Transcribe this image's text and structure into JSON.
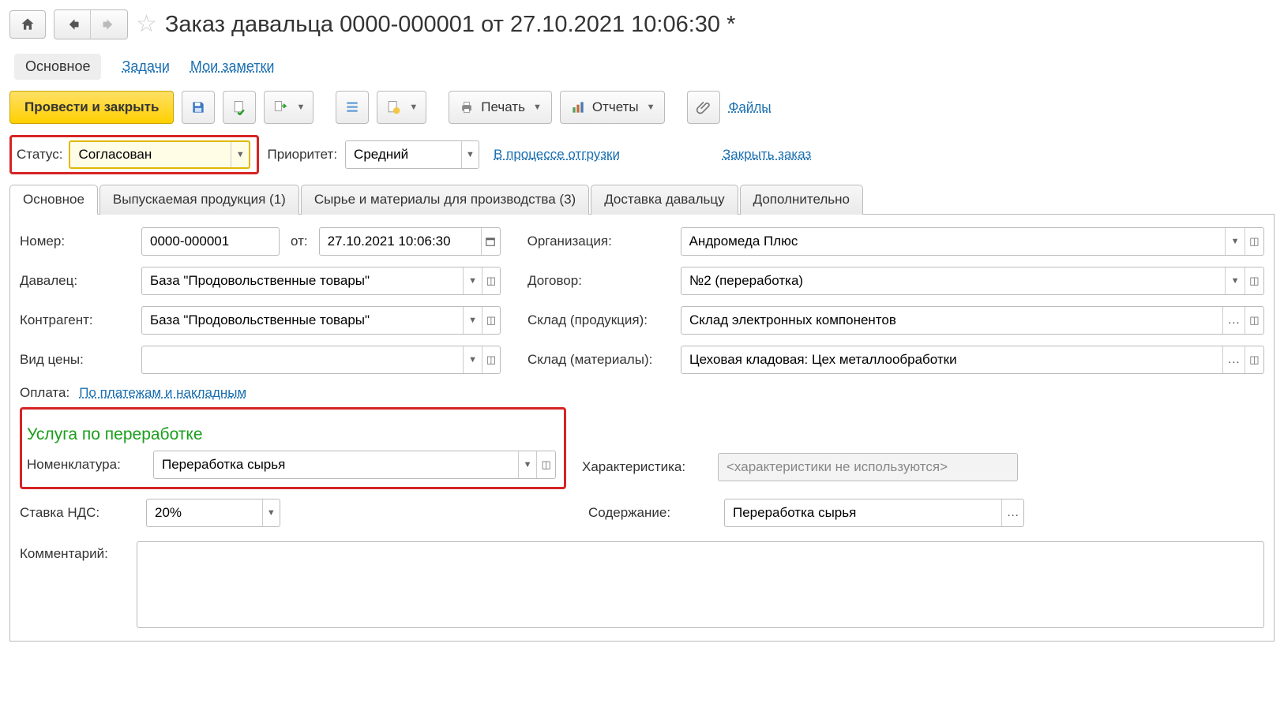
{
  "header": {
    "title": "Заказ давальца 0000-000001 от 27.10.2021 10:06:30 *"
  },
  "navTabs": {
    "main": "Основное",
    "tasks": "Задачи",
    "notes": "Мои заметки"
  },
  "toolbar": {
    "postAndClose": "Провести и закрыть",
    "print": "Печать",
    "reports": "Отчеты",
    "files": "Файлы"
  },
  "statusRow": {
    "statusLabel": "Статус:",
    "statusValue": "Согласован",
    "priorityLabel": "Приоритет:",
    "priorityValue": "Средний",
    "shippingLink": "В процессе отгрузки",
    "closeOrderLink": "Закрыть заказ"
  },
  "tabs": {
    "main": "Основное",
    "products": "Выпускаемая продукция (1)",
    "materials": "Сырье и материалы для производства (3)",
    "delivery": "Доставка давальцу",
    "extra": "Дополнительно"
  },
  "form": {
    "numberLabel": "Номер:",
    "numberValue": "0000-000001",
    "dateLabel": "от:",
    "dateValue": "27.10.2021 10:06:30",
    "orgLabel": "Организация:",
    "orgValue": "Андромеда Плюс",
    "supplierLabel": "Давалец:",
    "supplierValue": "База \"Продовольственные товары\"",
    "contractLabel": "Договор:",
    "contractValue": "№2 (переработка)",
    "counterpartyLabel": "Контрагент:",
    "counterpartyValue": "База \"Продовольственные товары\"",
    "prodWarehouseLabel": "Склад (продукция):",
    "prodWarehouseValue": "Склад электронных компонентов",
    "priceTypeLabel": "Вид цены:",
    "priceTypeValue": "",
    "matWarehouseLabel": "Склад (материалы):",
    "matWarehouseValue": "Цеховая кладовая: Цех металлообработки",
    "paymentLabel": "Оплата:",
    "paymentLink": "По платежам и накладным"
  },
  "service": {
    "title": "Услуга по переработке",
    "nomenclatureLabel": "Номенклатура:",
    "nomenclatureValue": "Переработка сырья",
    "characteristicLabel": "Характеристика:",
    "characteristicValue": "<характеристики не используются>",
    "vatLabel": "Ставка НДС:",
    "vatValue": "20%",
    "contentLabel": "Содержание:",
    "contentValue": "Переработка сырья",
    "commentLabel": "Комментарий:",
    "commentValue": ""
  }
}
